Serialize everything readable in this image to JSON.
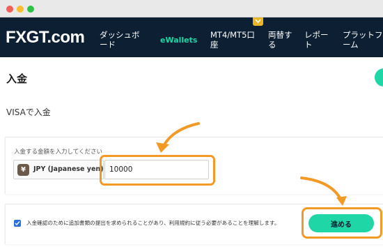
{
  "window": {
    "controls": [
      "close",
      "minimize",
      "maximize"
    ]
  },
  "header": {
    "logo_text": "FXGT.com",
    "nav": [
      {
        "label": "ダッシュボ\nード",
        "active": false
      },
      {
        "label": "eWallets",
        "active": true
      },
      {
        "label": "MT4/MT5口\n座",
        "active": false
      },
      {
        "label": "両替す\nる",
        "active": false
      },
      {
        "label": "レポー\nト",
        "active": false
      },
      {
        "label": "プラットフ\nーム",
        "active": false
      }
    ],
    "chevron_icon": "chevron-down-icon"
  },
  "page": {
    "title": "入金",
    "method_label": "VISAで入金"
  },
  "deposit_form": {
    "amount_label": "入金する金額を入力してください",
    "currency_symbol": "¥",
    "currency_text": "JPY (Japanese yen)",
    "amount_value": "10000"
  },
  "confirm": {
    "checked": true,
    "consent_text": "入金確認のために追加書類の提出を求められることがあり、利用規約に従う必要があることを理解します。",
    "proceed_label": "進める"
  },
  "colors": {
    "nav_bg": "#0c1f33",
    "accent": "#1ed6a6",
    "highlight": "#f29a25",
    "checkbox": "#2f6edb"
  }
}
